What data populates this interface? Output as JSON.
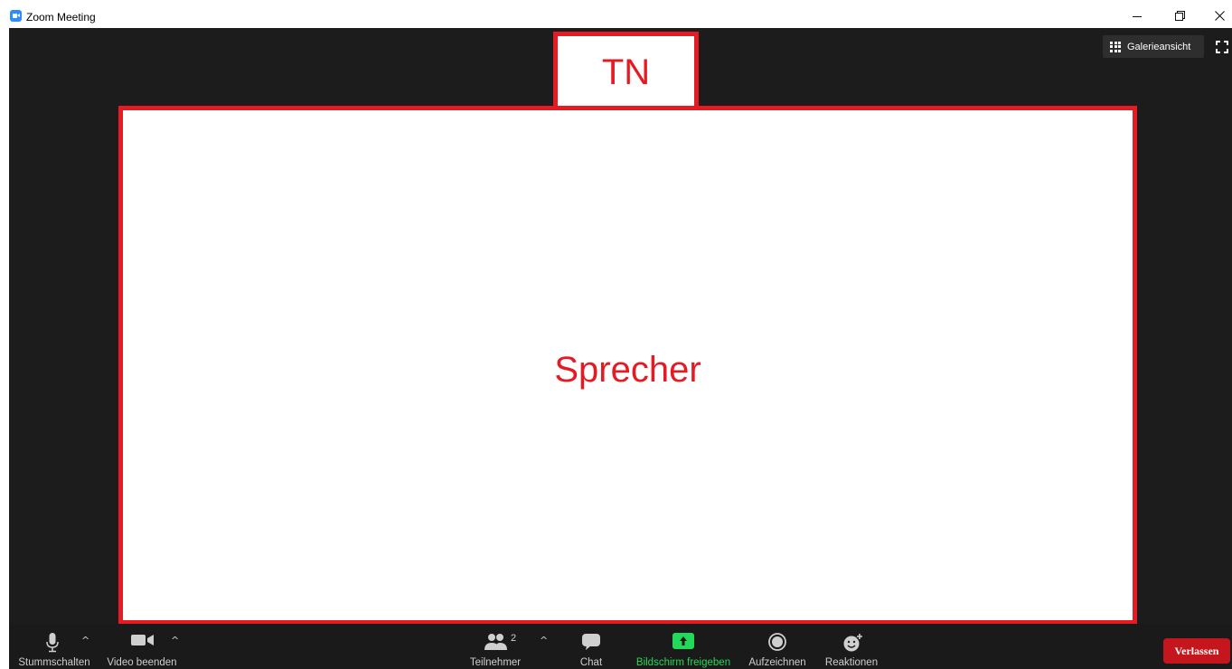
{
  "window": {
    "title": "Zoom Meeting"
  },
  "video": {
    "participant_label": "TN",
    "speaker_label": "Sprecher",
    "gallery_view_label": "Galerieansicht"
  },
  "toolbar": {
    "mute_label": "Stummschalten",
    "video_label": "Video beenden",
    "participants_label": "Teilnehmer",
    "participants_count": "2",
    "chat_label": "Chat",
    "share_label": "Bildschirm freigeben",
    "record_label": "Aufzeichnen",
    "reactions_label": "Reaktionen",
    "leave_label": "Verlassen"
  },
  "colors": {
    "accent_red": "#e51b23",
    "share_green": "#23d959",
    "leave_red": "#c4161c",
    "zoom_blue": "#2D8CFF"
  },
  "icons": [
    "zoom-logo-icon",
    "minimize-icon",
    "restore-icon",
    "close-icon",
    "grid-icon",
    "fullscreen-icon",
    "microphone-icon",
    "video-camera-icon",
    "participants-icon",
    "chat-icon",
    "share-screen-icon",
    "record-icon",
    "reactions-icon",
    "chevron-up-icon"
  ]
}
